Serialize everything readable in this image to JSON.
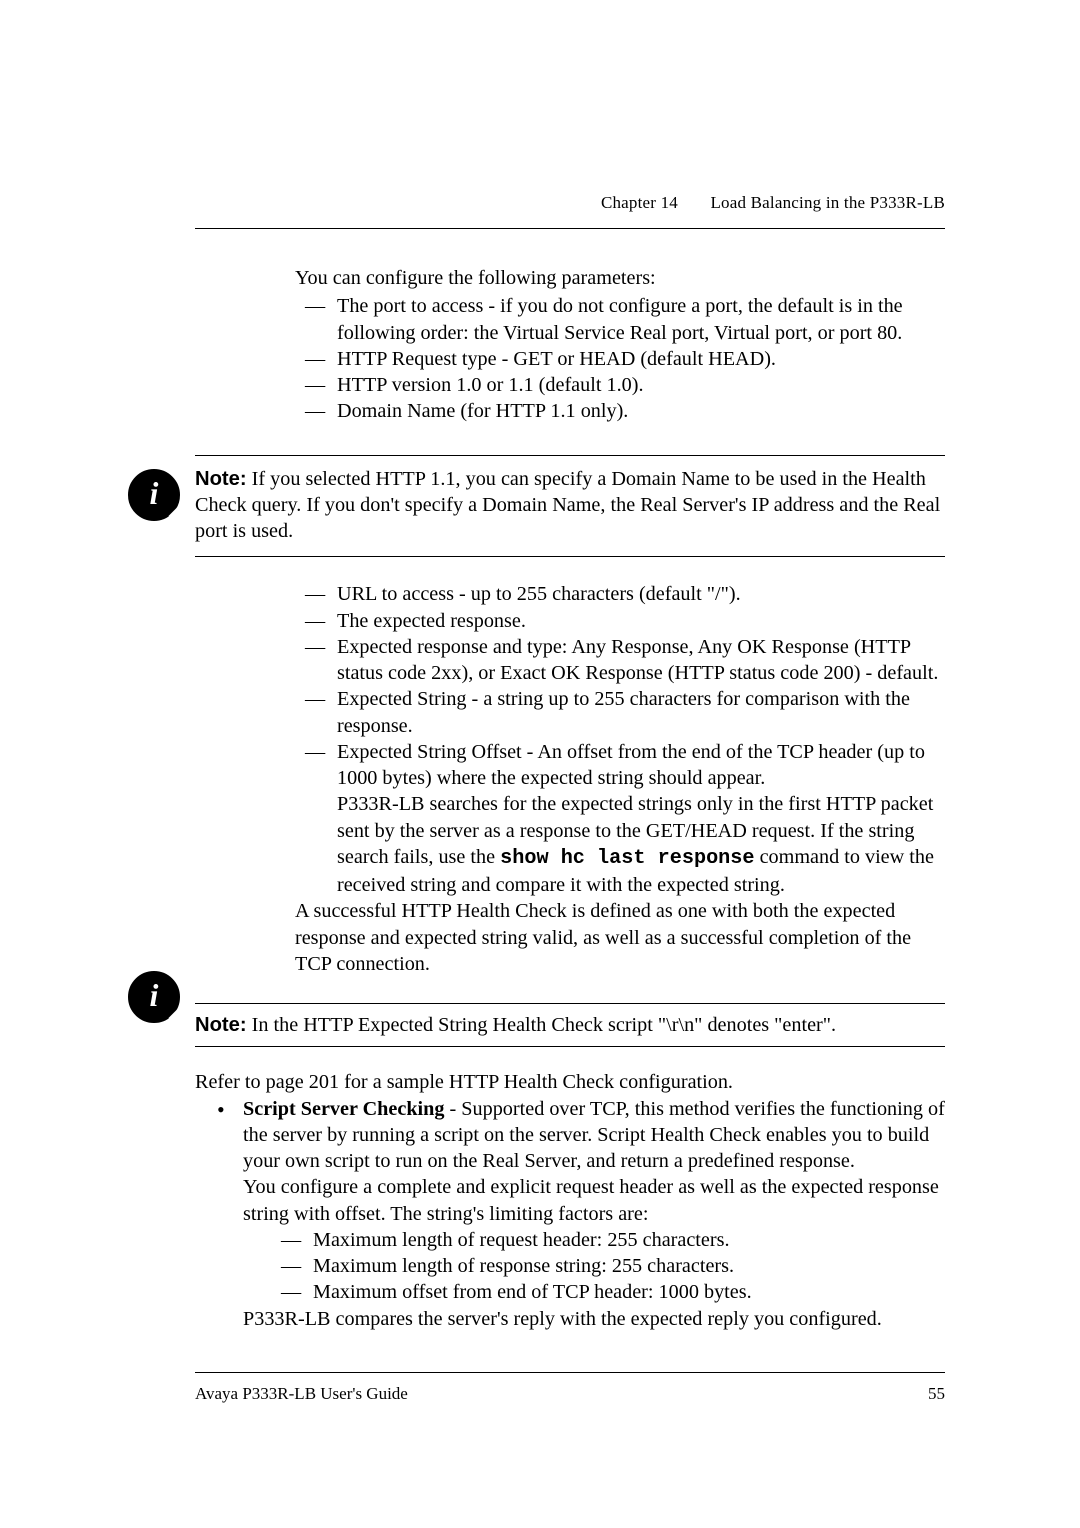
{
  "header": {
    "chapter": "Chapter 14",
    "title": "Load Balancing in the P333R-LB"
  },
  "block1": {
    "lead": "You can configure the following parameters:",
    "items": [
      "The port to access - if you do not configure a port, the default is in the following order: the Virtual Service Real port, Virtual port, or port 80.",
      "HTTP Request type - GET or HEAD (default HEAD).",
      "HTTP version 1.0 or 1.1 (default 1.0).",
      "Domain Name (for HTTP 1.1 only)."
    ]
  },
  "note1": {
    "label": "Note:",
    "body": "If you selected HTTP 1.1, you can specify a Domain Name to be used in the Health Check query. If you don't specify a Domain Name, the Real Server's IP address and the Real port is used."
  },
  "list2": {
    "items": [
      "URL to access - up to 255 characters (default \"/\").",
      "The expected response.",
      "Expected response and type: Any Response, Any OK Response (HTTP status code 2xx), or Exact OK Response (HTTP status code 200) - default.",
      "Expected String - a string up to 255 characters for comparison with the response."
    ],
    "last_item_pre": "Expected String Offset - An offset from the end of the TCP header (up to 1000 bytes) where the expected string should appear.",
    "last_item_mid_a": "P333R-LB searches for the expected strings only in the first HTTP packet sent by the server as a response to the GET/HEAD request. If the string search fails, use the ",
    "last_item_code": "show hc last response",
    "last_item_mid_b": " command to view the received string and compare it with the expected string.",
    "tcp_para": "A successful HTTP Health Check is defined as one with both the expected response and expected string valid, as well as a successful completion of the TCP connection."
  },
  "note2": {
    "label": "Note:",
    "body": "In the HTTP Expected String Health Check script \"\\r\\n\" denotes \"enter\"."
  },
  "refer": "Refer to page 201 for a sample HTTP Health Check configuration.",
  "bullet": {
    "strong": "Script Server Checking",
    "after_strong": " - Supported over TCP, this method verifies the functioning of the server by running a script on the server. Script Health Check enables you to build your own script to run on the Real Server, and return a predefined response.",
    "para2": "You configure a complete and explicit request header as well as the expected response string with offset. The string's limiting factors are:",
    "subitems": [
      "Maximum length of request header: 255 characters.",
      "Maximum length of response string: 255 characters.",
      "Maximum offset from end of TCP header: 1000 bytes."
    ],
    "tail": "P333R-LB compares the server's reply with the expected reply you configured."
  },
  "footer": {
    "left": "Avaya P333R-LB User's Guide",
    "right": "55"
  },
  "icons": {
    "info": "i"
  }
}
